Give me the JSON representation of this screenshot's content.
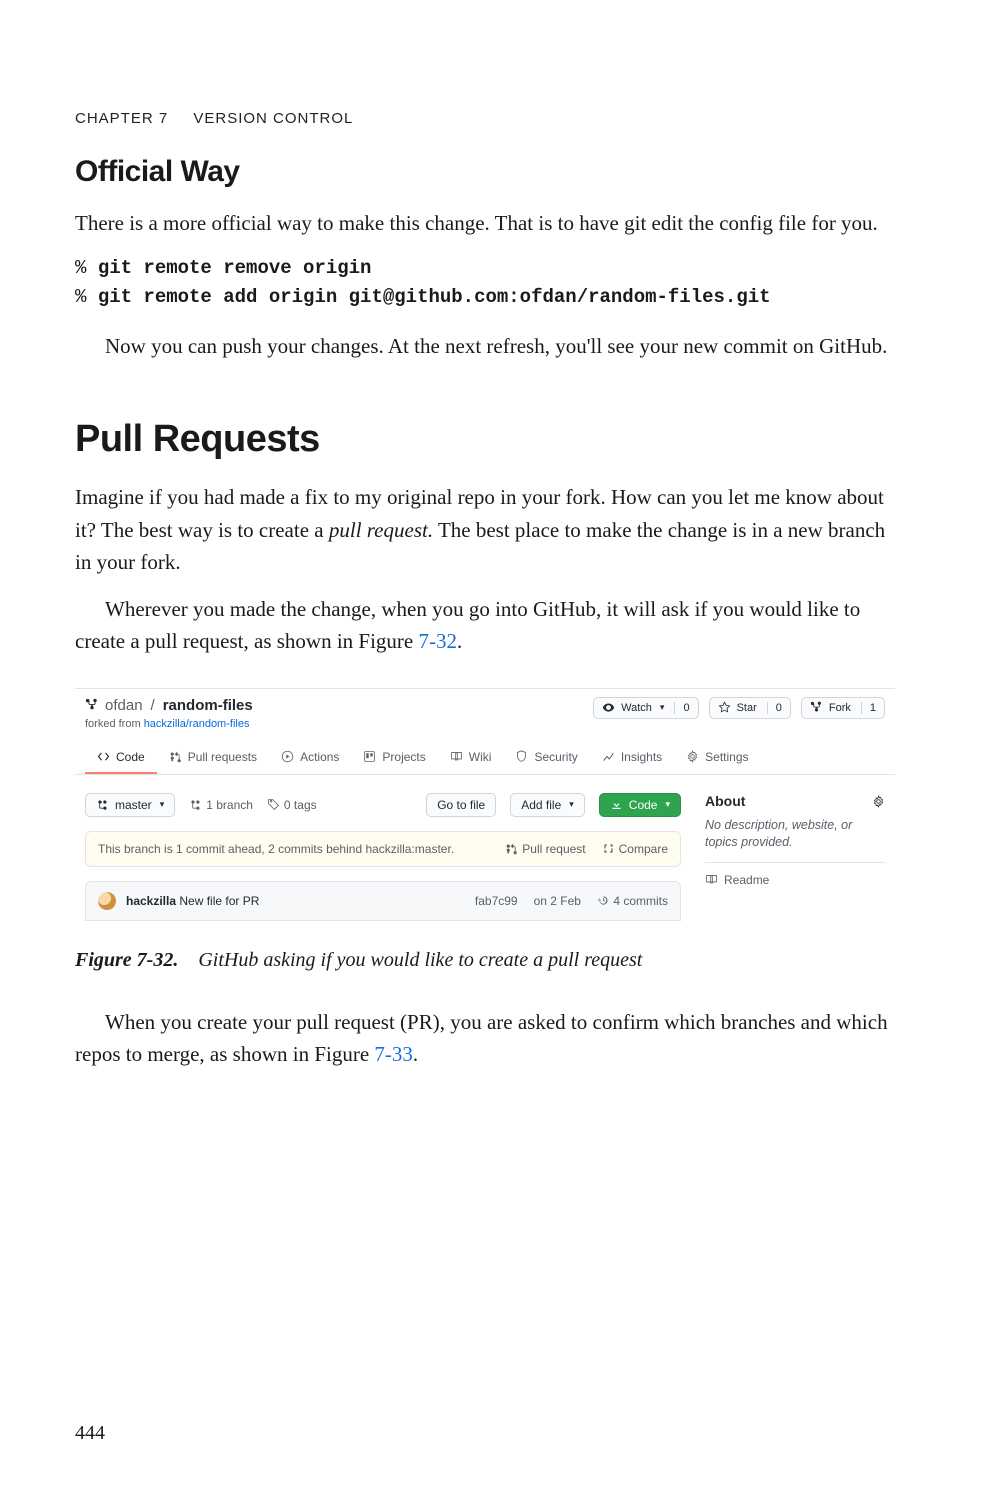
{
  "runningHead": {
    "chapter": "CHAPTER 7",
    "title": "VERSION CONTROL"
  },
  "sectionOfficial": {
    "heading": "Official Way",
    "p1": "There is a more official way to make this change. That is to have git edit the config file for you.",
    "cmd1Prefix": "% ",
    "cmd1Bold": "git remote remove origin",
    "cmd2Prefix": "% ",
    "cmd2Bold": "git remote add origin git@github.com:ofdan/random-files.git",
    "p2": "Now you can push your changes. At the next refresh, you'll see your new commit on GitHub."
  },
  "sectionPull": {
    "heading": "Pull Requests",
    "p1a": "Imagine if you had made a fix to my original repo in your fork. How can you let me know about it? The best way is to create a ",
    "p1term": "pull request.",
    "p1b": " The best place to make the change is in a new branch in your fork.",
    "p2a": "Wherever you made the change, when you go into GitHub, it will ask if you would like to create a pull request, as shown in Figure ",
    "p2ref": "7-32",
    "p2b": "."
  },
  "figure": {
    "num": "Figure 7-32.",
    "caption": "GitHub asking if you would like to create a pull request"
  },
  "afterFigure": {
    "p1a": "When you create your pull request (PR), you are asked to confirm which branches and which repos to merge, as shown in Figure ",
    "p1ref": "7-33",
    "p1b": "."
  },
  "pageNumber": "444",
  "gh": {
    "owner": "ofdan",
    "repo": "random-files",
    "forkedPrefix": "forked from ",
    "forkedLink": "hackzilla/random-files",
    "watch": {
      "label": "Watch",
      "count": "0"
    },
    "star": {
      "label": "Star",
      "count": "0"
    },
    "fork": {
      "label": "Fork",
      "count": "1"
    },
    "tabs": {
      "code": "Code",
      "pulls": "Pull requests",
      "actions": "Actions",
      "projects": "Projects",
      "wiki": "Wiki",
      "security": "Security",
      "insights": "Insights",
      "settings": "Settings"
    },
    "branchBtn": "master",
    "branchCount": "1 branch",
    "tagCount": "0 tags",
    "goToFile": "Go to file",
    "addFile": "Add file",
    "codeBtn": "Code",
    "compareText": "This branch is 1 commit ahead, 2 commits behind hackzilla:master.",
    "compareActions": {
      "pr": "Pull request",
      "compare": "Compare"
    },
    "commit": {
      "author": "hackzilla",
      "message": "New file for PR",
      "sha": "fab7c99",
      "dateLabel": "on 2 Feb",
      "countLabel": "4 commits"
    },
    "about": {
      "heading": "About",
      "desc": "No description, website, or topics provided.",
      "readme": "Readme"
    }
  }
}
